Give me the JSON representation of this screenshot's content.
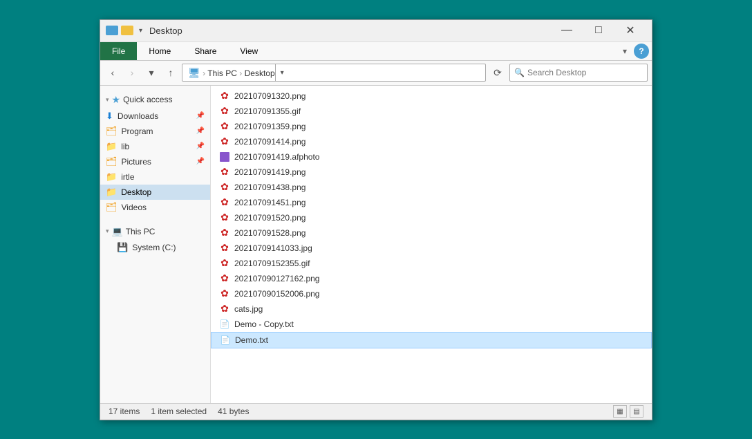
{
  "window": {
    "title": "Desktop",
    "icons": [
      "screen-icon",
      "folder-icon",
      "dropdown-arrow"
    ],
    "controls": {
      "minimize": "—",
      "maximize": "□",
      "close": "✕"
    }
  },
  "ribbon": {
    "tabs": [
      {
        "id": "file",
        "label": "File",
        "active": true
      },
      {
        "id": "home",
        "label": "Home",
        "active": false
      },
      {
        "id": "share",
        "label": "Share",
        "active": false
      },
      {
        "id": "view",
        "label": "View",
        "active": false
      }
    ],
    "help_btn": "?"
  },
  "address_bar": {
    "back_btn": "‹",
    "forward_btn": "›",
    "up_btn": "↑",
    "breadcrumb": [
      "This PC",
      "Desktop"
    ],
    "search_placeholder": "Search Desktop",
    "refresh_btn": "⟳"
  },
  "sidebar": {
    "quick_access_label": "Quick access",
    "items": [
      {
        "id": "downloads",
        "label": "Downloads",
        "pinned": true,
        "icon": "download"
      },
      {
        "id": "programs",
        "label": "Program",
        "pinned": true,
        "icon": "folder"
      },
      {
        "id": "lib",
        "label": "lib",
        "pinned": true,
        "icon": "folder-special"
      },
      {
        "id": "pictures",
        "label": "Pictures",
        "pinned": true,
        "icon": "folder"
      },
      {
        "id": "irtle",
        "label": "irtle",
        "pinned": false,
        "icon": "folder-yellow"
      },
      {
        "id": "desktop",
        "label": "Desktop",
        "pinned": false,
        "icon": "folder-blue",
        "active": true
      },
      {
        "id": "videos",
        "label": "Videos",
        "pinned": false,
        "icon": "folder-special"
      }
    ],
    "this_pc_label": "This PC",
    "drives": [
      {
        "id": "system-c",
        "label": "System (C:)",
        "icon": "drive"
      }
    ]
  },
  "files": [
    {
      "name": "202107091320.png",
      "type": "png",
      "icon": "image"
    },
    {
      "name": "202107091355.gif",
      "type": "gif",
      "icon": "image"
    },
    {
      "name": "202107091359.png",
      "type": "png",
      "icon": "image"
    },
    {
      "name": "202107091414.png",
      "type": "png",
      "icon": "image"
    },
    {
      "name": "202107091419.afphoto",
      "type": "afphoto",
      "icon": "afphoto"
    },
    {
      "name": "202107091419.png",
      "type": "png",
      "icon": "image"
    },
    {
      "name": "202107091438.png",
      "type": "png",
      "icon": "image"
    },
    {
      "name": "202107091451.png",
      "type": "png",
      "icon": "image"
    },
    {
      "name": "202107091520.png",
      "type": "png",
      "icon": "image"
    },
    {
      "name": "202107091528.png",
      "type": "png",
      "icon": "image"
    },
    {
      "name": "20210709141033.jpg",
      "type": "jpg",
      "icon": "image"
    },
    {
      "name": "20210709152355.gif",
      "type": "gif",
      "icon": "image"
    },
    {
      "name": "202107090127162.png",
      "type": "png",
      "icon": "image"
    },
    {
      "name": "202107090152006.png",
      "type": "png",
      "icon": "image"
    },
    {
      "name": "cats.jpg",
      "type": "jpg",
      "icon": "image"
    },
    {
      "name": "Demo - Copy.txt",
      "type": "txt",
      "icon": "txt"
    },
    {
      "name": "Demo.txt",
      "type": "txt",
      "icon": "txt",
      "selected": true
    }
  ],
  "status": {
    "item_count": "17 items",
    "selected_info": "1 item selected",
    "file_size": "41 bytes"
  }
}
